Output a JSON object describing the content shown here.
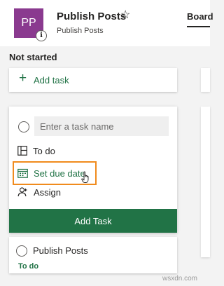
{
  "header": {
    "avatar_initials": "PP",
    "info_glyph": "i",
    "plan_title": "Publish Posts",
    "star_glyph": "☆",
    "plan_subtitle": "Publish Posts",
    "tab_board": "Board"
  },
  "bucket": {
    "name": "Not started",
    "add_task_label": "Add task"
  },
  "new_task": {
    "name_placeholder": "Enter a task name",
    "bucket_label": "To do",
    "due_date_label": "Set due date",
    "assign_label": "Assign",
    "add_button_label": "Add Task"
  },
  "existing_task": {
    "title": "Publish Posts",
    "bucket": "To do"
  },
  "watermark": "wsxdn.com",
  "colors": {
    "accent_green": "#217346",
    "avatar_purple": "#8a3a8f",
    "highlight_orange": "#f08b1d"
  }
}
